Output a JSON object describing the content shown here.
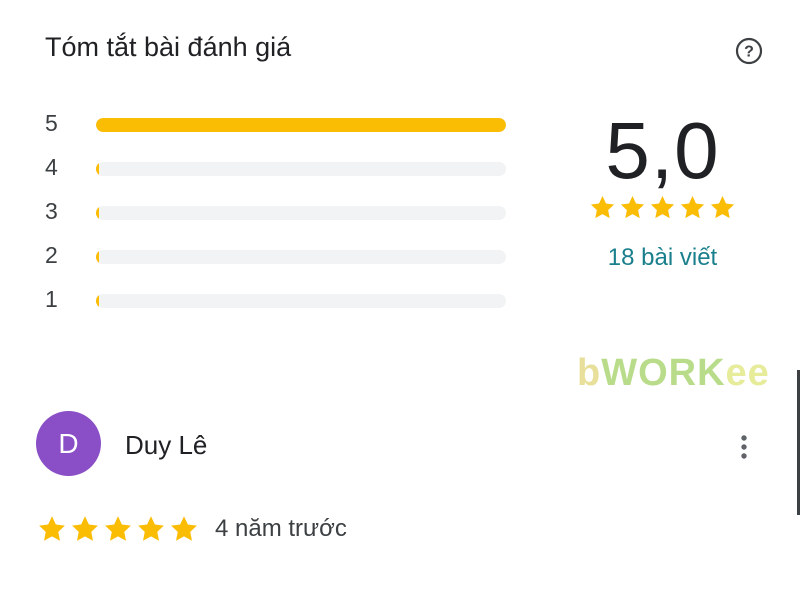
{
  "title": "Tóm tắt bài đánh giá",
  "colors": {
    "star": "#fbbc04",
    "track": "#f1f3f4",
    "link": "#1a7f8c",
    "avatar": "#8a4fc7"
  },
  "distribution": [
    {
      "label": "5",
      "fraction": 1.0
    },
    {
      "label": "4",
      "fraction": 0.0
    },
    {
      "label": "3",
      "fraction": 0.0
    },
    {
      "label": "2",
      "fraction": 0.0
    },
    {
      "label": "1",
      "fraction": 0.0
    }
  ],
  "summary": {
    "average": "5,0",
    "stars": 5,
    "count_label": "18 bài viết"
  },
  "watermark": {
    "b": "b",
    "work": "WORK",
    "ee": "ee"
  },
  "review": {
    "avatar_letter": "D",
    "author": "Duy Lê",
    "stars": 5,
    "date": "4 năm trước"
  },
  "icons": {
    "help": "help-circle-icon",
    "more": "more-vert-icon",
    "star": "star-icon"
  }
}
